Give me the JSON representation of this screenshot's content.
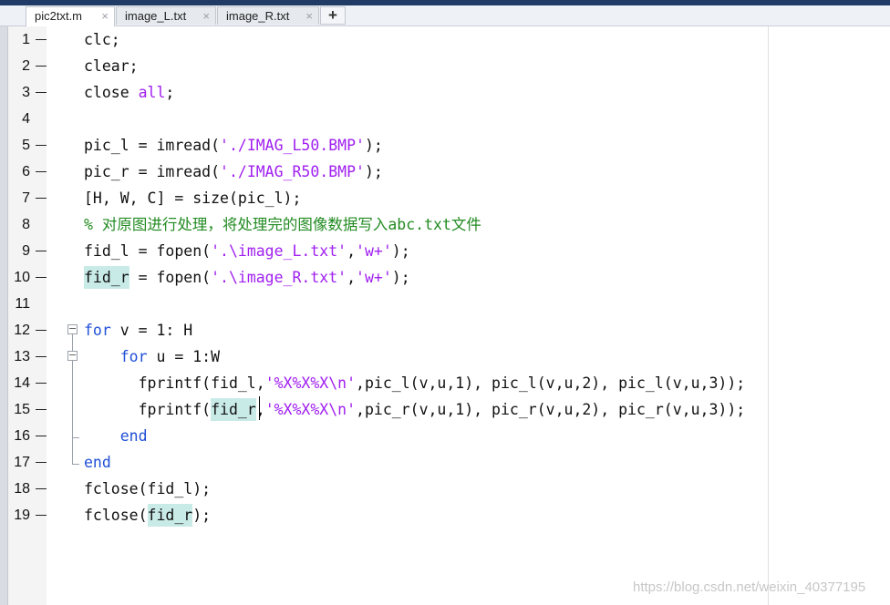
{
  "tabs": [
    {
      "label": "pic2txt.m",
      "active": true
    },
    {
      "label": "image_L.txt",
      "active": false
    },
    {
      "label": "image_R.txt",
      "active": false
    }
  ],
  "tab_close_glyph": "×",
  "add_tab_glyph": "+",
  "editor": {
    "lines": [
      {
        "num": "1",
        "parts": [
          {
            "t": "clc;",
            "c": "txt"
          }
        ]
      },
      {
        "num": "2",
        "parts": [
          {
            "t": "clear;",
            "c": "txt"
          }
        ]
      },
      {
        "num": "3",
        "parts": [
          {
            "t": "close ",
            "c": "txt"
          },
          {
            "t": "all",
            "c": "str"
          },
          {
            "t": ";",
            "c": "txt"
          }
        ]
      },
      {
        "num": "4",
        "parts": []
      },
      {
        "num": "5",
        "parts": [
          {
            "t": "pic_l = imread(",
            "c": "txt"
          },
          {
            "t": "'./IMAG_L50.BMP'",
            "c": "str"
          },
          {
            "t": ");",
            "c": "txt"
          }
        ]
      },
      {
        "num": "6",
        "parts": [
          {
            "t": "pic_r = imread(",
            "c": "txt"
          },
          {
            "t": "'./IMAG_R50.BMP'",
            "c": "str"
          },
          {
            "t": ");",
            "c": "txt"
          }
        ]
      },
      {
        "num": "7",
        "parts": [
          {
            "t": "[H, W, C] = size(pic_l);",
            "c": "txt"
          }
        ]
      },
      {
        "num": "8",
        "parts": [
          {
            "t": "% 对原图进行处理，将处理完的图像数据写入abc.txt文件",
            "c": "cmt"
          }
        ]
      },
      {
        "num": "9",
        "parts": [
          {
            "t": "fid_l = fopen(",
            "c": "txt"
          },
          {
            "t": "'.\\image_L.txt'",
            "c": "str"
          },
          {
            "t": ",",
            "c": "txt"
          },
          {
            "t": "'w+'",
            "c": "str"
          },
          {
            "t": ");",
            "c": "txt"
          }
        ]
      },
      {
        "num": "10",
        "parts": [
          {
            "t": "fid_r",
            "c": "hl"
          },
          {
            "t": " = fopen(",
            "c": "txt"
          },
          {
            "t": "'.\\image_R.txt'",
            "c": "str"
          },
          {
            "t": ",",
            "c": "txt"
          },
          {
            "t": "'w+'",
            "c": "str"
          },
          {
            "t": ");",
            "c": "txt"
          }
        ]
      },
      {
        "num": "11",
        "parts": []
      },
      {
        "num": "12",
        "parts": [
          {
            "t": "for",
            "c": "kw"
          },
          {
            "t": " v = 1: H",
            "c": "txt"
          }
        ]
      },
      {
        "num": "13",
        "parts": [
          {
            "t": "    ",
            "c": "txt"
          },
          {
            "t": "for",
            "c": "kw"
          },
          {
            "t": " u = 1:W",
            "c": "txt"
          }
        ]
      },
      {
        "num": "14",
        "parts": [
          {
            "t": "      fprintf(fid_l,",
            "c": "txt"
          },
          {
            "t": "'%X%X%X\\n'",
            "c": "str"
          },
          {
            "t": ",pic_l(v,u,1), pic_l(v,u,2), pic_l(v,u,3));",
            "c": "txt"
          }
        ]
      },
      {
        "num": "15",
        "parts": [
          {
            "t": "      fprintf(",
            "c": "txt"
          },
          {
            "t": "fid_r",
            "c": "hl"
          },
          {
            "t": ",",
            "c": "txt"
          },
          {
            "t": "'%X%X%X\\n'",
            "c": "str"
          },
          {
            "t": ",pic_r(v,u,1), pic_r(v,u,2), pic_r(v,u,3));",
            "c": "txt"
          }
        ]
      },
      {
        "num": "16",
        "parts": [
          {
            "t": "    ",
            "c": "txt"
          },
          {
            "t": "end",
            "c": "kw"
          }
        ]
      },
      {
        "num": "17",
        "parts": [
          {
            "t": "end",
            "c": "kw"
          }
        ]
      },
      {
        "num": "18",
        "parts": [
          {
            "t": "fclose(fid_l);",
            "c": "txt"
          }
        ]
      },
      {
        "num": "19",
        "parts": [
          {
            "t": "fclose(",
            "c": "txt"
          },
          {
            "t": "fid_r",
            "c": "hl"
          },
          {
            "t": ");",
            "c": "txt"
          }
        ]
      }
    ],
    "execution_markers": [
      "1",
      "2",
      "3",
      "5",
      "6",
      "7",
      "9",
      "10",
      "12",
      "13",
      "14",
      "15",
      "16",
      "17",
      "18",
      "19"
    ]
  },
  "watermark": "https://blog.csdn.net/weixin_40377195",
  "colors": {
    "keyword": "#1f4fd6",
    "string": "#a020f0",
    "comment": "#228b22",
    "highlight": "#c9ebe8"
  }
}
